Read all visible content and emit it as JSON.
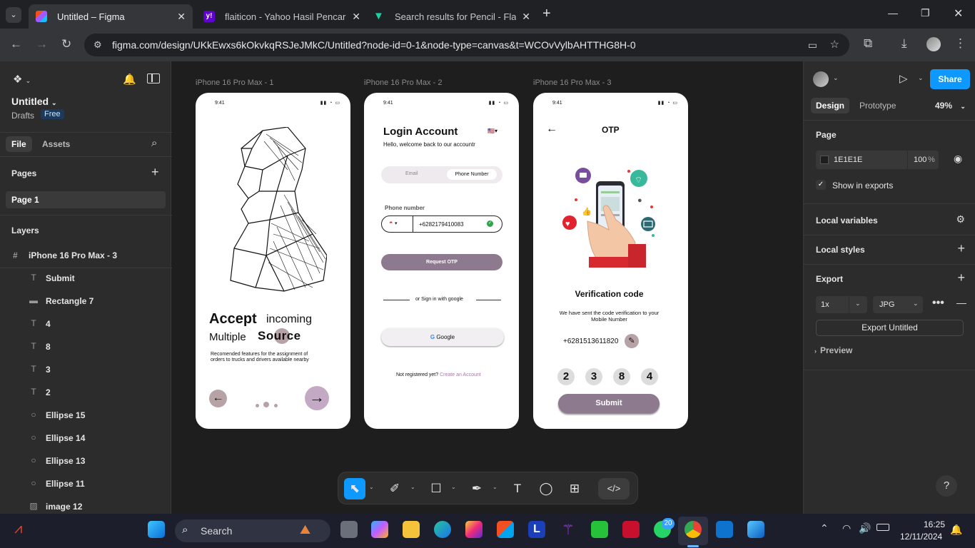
{
  "browser": {
    "tabs": [
      {
        "title": "Untitled – Figma",
        "color": "#f24e1e"
      },
      {
        "title": "flaiticon - Yahoo Hasil Pencarian",
        "color": "#6001d2"
      },
      {
        "title": "Search results for Pencil - Flaticon",
        "color": "#1bd2a4"
      }
    ],
    "new_tab": "+",
    "url": "figma.com/design/UKkEwxs6kOkvkqRSJeJMkC/Untitled?node-id=0-1&node-type=canvas&t=WCOvVylbAHTTHG8H-0"
  },
  "left": {
    "file_name": "Untitled",
    "drafts": "Drafts",
    "plan_badge": "Free",
    "tab_file": "File",
    "tab_assets": "Assets",
    "pages_title": "Pages",
    "page1": "Page 1",
    "layers_title": "Layers",
    "frame_layer": "iPhone 16 Pro Max - 3",
    "layers": [
      {
        "icon": "T",
        "name": "Submit",
        "icon_name": "text-icon"
      },
      {
        "icon": "▬",
        "name": "Rectangle 7",
        "icon_name": "rectangle-icon"
      },
      {
        "icon": "T",
        "name": "4",
        "icon_name": "text-icon"
      },
      {
        "icon": "T",
        "name": "8",
        "icon_name": "text-icon"
      },
      {
        "icon": "T",
        "name": "3",
        "icon_name": "text-icon"
      },
      {
        "icon": "T",
        "name": "2",
        "icon_name": "text-icon"
      },
      {
        "icon": "○",
        "name": "Ellipse 15",
        "icon_name": "ellipse-icon"
      },
      {
        "icon": "○",
        "name": "Ellipse 14",
        "icon_name": "ellipse-icon"
      },
      {
        "icon": "○",
        "name": "Ellipse 13",
        "icon_name": "ellipse-icon"
      },
      {
        "icon": "○",
        "name": "Ellipse 11",
        "icon_name": "ellipse-icon"
      },
      {
        "icon": "▨",
        "name": "image 12",
        "icon_name": "image-icon"
      }
    ]
  },
  "canvas": {
    "frame_labels": [
      "iPhone 16 Pro Max - 1",
      "iPhone 16 Pro Max - 2",
      "iPhone 16 Pro Max - 3"
    ],
    "time": "9:41",
    "p1": {
      "accept": "Accept",
      "incoming": "incoming",
      "multiple": "Multiple",
      "source": "Source",
      "desc": "Recomended features for the assignment of orders to trucks and drivers available nearby"
    },
    "p2": {
      "title": "Login Account",
      "subtitle": "Hello, welcome back to our accountr",
      "tab_email": "Email",
      "tab_phone": "Phone Number",
      "phone_label": "Phone number",
      "phone_value": "+6282179410083",
      "request_btn": "Request OTP",
      "divider": "or Sign in with google",
      "google_btn": "Google",
      "not_registered": "Not registered yet?",
      "create_account": "Create an Account"
    },
    "p3": {
      "title": "OTP",
      "verif_title": "Verification code",
      "verif_desc": "We have sent the code verification to your Mobile Number",
      "number": "+6281513611820",
      "digits": [
        "2",
        "3",
        "8",
        "4"
      ],
      "submit": "Submit"
    }
  },
  "right": {
    "tab_design": "Design",
    "tab_prototype": "Prototype",
    "zoom": "49%",
    "share": "Share",
    "page_title": "Page",
    "bg_color": "1E1E1E",
    "opacity": "100",
    "pct": "%",
    "show_exports": "Show in exports",
    "local_variables": "Local variables",
    "local_styles": "Local styles",
    "export_title": "Export",
    "scale": "1x",
    "format": "JPG",
    "export_btn": "Export Untitled",
    "preview": "Preview"
  },
  "taskbar": {
    "search": "Search",
    "time": "16:25",
    "date": "12/11/2024",
    "whatsapp_badge": "20"
  },
  "colors": {
    "accent": "#0d99ff",
    "mauve": "#8e7a8e",
    "figma_bg": "#1e1e1e",
    "panel": "#2c2c2c"
  }
}
